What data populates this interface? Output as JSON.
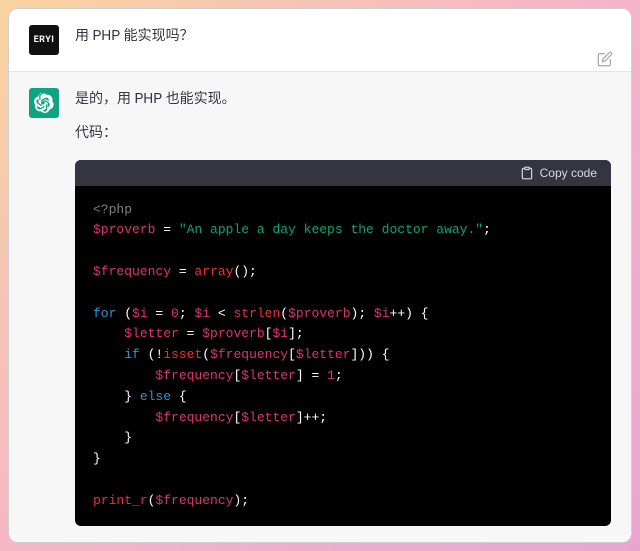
{
  "user": {
    "avatar_label": "ERYI",
    "message": "用 PHP 能实现吗？"
  },
  "assistant": {
    "intro": "是的，用 PHP 也能实现。",
    "code_label": "代码：",
    "copy_label": "Copy code",
    "code": {
      "l1_open": "<?php",
      "l2_var": "$proverb",
      "l2_eq": " = ",
      "l2_str": "\"An apple a day keeps the doctor away.\"",
      "l2_end": ";",
      "l3_var": "$frequency",
      "l3_eq": " = ",
      "l3_fn": "array",
      "l3_paren": "();",
      "l4_for": "for",
      "l4_open": " (",
      "l4_i": "$i",
      "l4_eq0": " = ",
      "l4_zero": "0",
      "l4_semi1": "; ",
      "l4_i2": "$i",
      "l4_lt": " < ",
      "l4_strlen": "strlen",
      "l4_po": "(",
      "l4_prov": "$proverb",
      "l4_pc": "); ",
      "l4_i3": "$i",
      "l4_inc": "++) {",
      "l5_ind": "    ",
      "l5_letter": "$letter",
      "l5_eq": " = ",
      "l5_prov": "$proverb",
      "l5_bo": "[",
      "l5_i": "$i",
      "l5_bc": "];",
      "l6_ind": "    ",
      "l6_if": "if",
      "l6_open": " (!",
      "l6_isset": "isset",
      "l6_po": "(",
      "l6_freq": "$frequency",
      "l6_bo": "[",
      "l6_letter": "$letter",
      "l6_bc": "])) {",
      "l7_ind": "        ",
      "l7_freq": "$frequency",
      "l7_bo": "[",
      "l7_letter": "$letter",
      "l7_bc": "] = ",
      "l7_one": "1",
      "l7_end": ";",
      "l8_ind": "    } ",
      "l8_else": "else",
      "l8_open": " {",
      "l9_ind": "        ",
      "l9_freq": "$frequency",
      "l9_bo": "[",
      "l9_letter": "$letter",
      "l9_bc": "]++;",
      "l10": "    }",
      "l11": "}",
      "l12_fn": "print_r",
      "l12_po": "(",
      "l12_freq": "$frequency",
      "l12_pc": ");"
    }
  }
}
